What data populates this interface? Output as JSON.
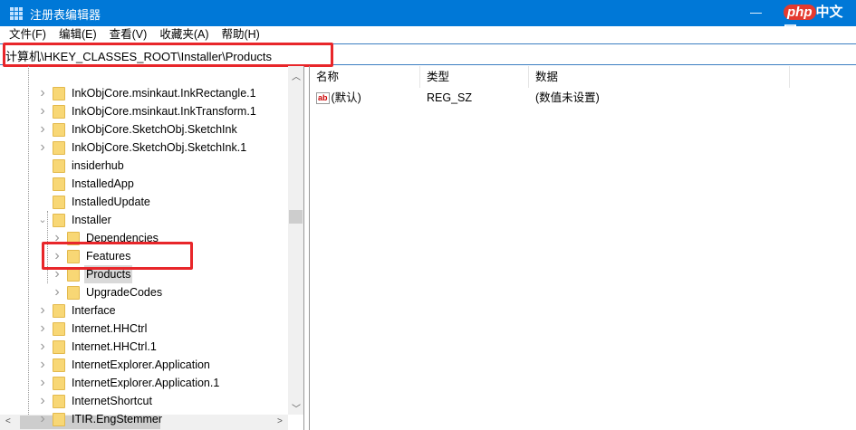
{
  "window": {
    "title": "注册表编辑器",
    "minimize": "—",
    "watermark_brand": "php",
    "watermark_text": "中文网"
  },
  "menu": [
    "文件(F)",
    "编辑(E)",
    "查看(V)",
    "收藏夹(A)",
    "帮助(H)"
  ],
  "address": "计算机\\HKEY_CLASSES_ROOT\\Installer\\Products",
  "tree": [
    {
      "label": "InkObjCore.msinkaut.InkRectangle.1",
      "level": 1,
      "chevron": "right"
    },
    {
      "label": "InkObjCore.msinkaut.InkTransform.1",
      "level": 1,
      "chevron": "right"
    },
    {
      "label": "InkObjCore.SketchObj.SketchInk",
      "level": 1,
      "chevron": "right"
    },
    {
      "label": "InkObjCore.SketchObj.SketchInk.1",
      "level": 1,
      "chevron": "right"
    },
    {
      "label": "insiderhub",
      "level": 1,
      "chevron": ""
    },
    {
      "label": "InstalledApp",
      "level": 1,
      "chevron": ""
    },
    {
      "label": "InstalledUpdate",
      "level": 1,
      "chevron": ""
    },
    {
      "label": "Installer",
      "level": 1,
      "chevron": "down"
    },
    {
      "label": "Dependencies",
      "level": 2,
      "chevron": "right"
    },
    {
      "label": "Features",
      "level": 2,
      "chevron": "right"
    },
    {
      "label": "Products",
      "level": 2,
      "chevron": "right",
      "selected": true
    },
    {
      "label": "UpgradeCodes",
      "level": 2,
      "chevron": "right"
    },
    {
      "label": "Interface",
      "level": 1,
      "chevron": "right"
    },
    {
      "label": "Internet.HHCtrl",
      "level": 1,
      "chevron": "right"
    },
    {
      "label": "Internet.HHCtrl.1",
      "level": 1,
      "chevron": "right"
    },
    {
      "label": "InternetExplorer.Application",
      "level": 1,
      "chevron": "right"
    },
    {
      "label": "InternetExplorer.Application.1",
      "level": 1,
      "chevron": "right"
    },
    {
      "label": "InternetShortcut",
      "level": 1,
      "chevron": "right"
    },
    {
      "label": "ITIR.EngStemmer",
      "level": 1,
      "chevron": "right"
    }
  ],
  "columns": [
    "名称",
    "类型",
    "数据"
  ],
  "values": [
    {
      "name": "(默认)",
      "type": "REG_SZ",
      "data": "(数值未设置)",
      "icon": "ab"
    }
  ],
  "colors": {
    "titlebar": "#0078d7",
    "highlight": "#e8262a"
  }
}
